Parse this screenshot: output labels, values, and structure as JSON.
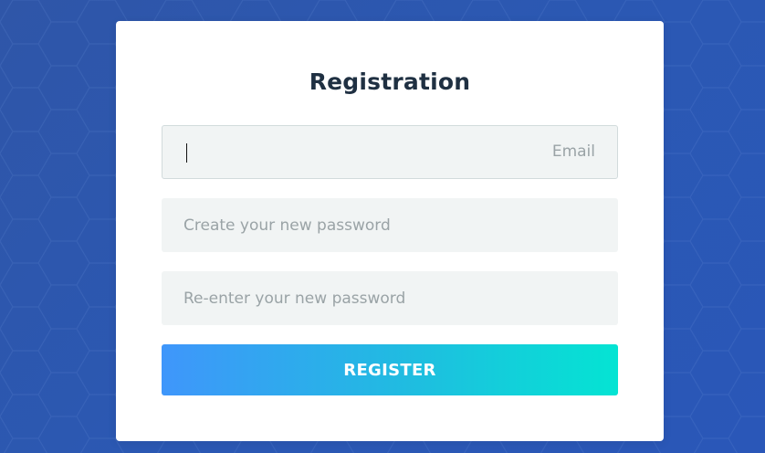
{
  "form": {
    "title": "Registration",
    "email": {
      "label": "Email",
      "value": ""
    },
    "password": {
      "placeholder": "Create your new password"
    },
    "confirm_password": {
      "placeholder": "Re-enter your new password"
    },
    "submit_label": "REGISTER"
  },
  "colors": {
    "background": "#2b58b3",
    "card": "#ffffff",
    "title": "#1f3042",
    "field_bg": "#f1f4f4",
    "placeholder": "#9aa3a6",
    "button_gradient_start": "#3f96fb",
    "button_gradient_end": "#04e4d3"
  }
}
